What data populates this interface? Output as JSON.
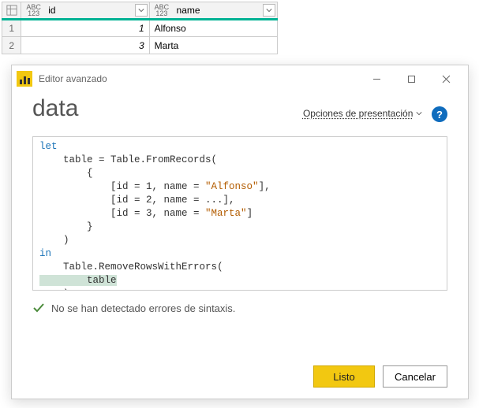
{
  "table": {
    "columns": [
      {
        "type_label_top": "ABC",
        "type_label_bot": "123",
        "name": "id"
      },
      {
        "type_label_top": "ABC",
        "type_label_bot": "123",
        "name": "name"
      }
    ],
    "rows": [
      {
        "index": "1",
        "id": "1",
        "name": "Alfonso"
      },
      {
        "index": "2",
        "id": "3",
        "name": "Marta"
      }
    ]
  },
  "dialog": {
    "title": "Editor avanzado",
    "heading": "data",
    "display_options_label": "Opciones de presentación",
    "help_glyph": "?",
    "code": {
      "l1_kw": "let",
      "l2a": "    table = ",
      "l2b_fn": "Table.FromRecords",
      "l2c": "(",
      "l3": "        {",
      "l4a": "            [id = 1, name = ",
      "l4b_str": "\"Alfonso\"",
      "l4c": "],",
      "l5": "            [id = 2, name = ...],",
      "l6a": "            [id = 3, name = ",
      "l6b_str": "\"Marta\"",
      "l6c": "]",
      "l7": "        }",
      "l8": "    )",
      "l9_kw": "in",
      "l10a": "    ",
      "l10b_fn": "Table.RemoveRowsWithErrors",
      "l10c": "(",
      "l11_sel": "        table",
      "l12": "    )"
    },
    "status": "No se han detectado errores de sintaxis.",
    "buttons": {
      "ok": "Listo",
      "cancel": "Cancelar"
    }
  }
}
